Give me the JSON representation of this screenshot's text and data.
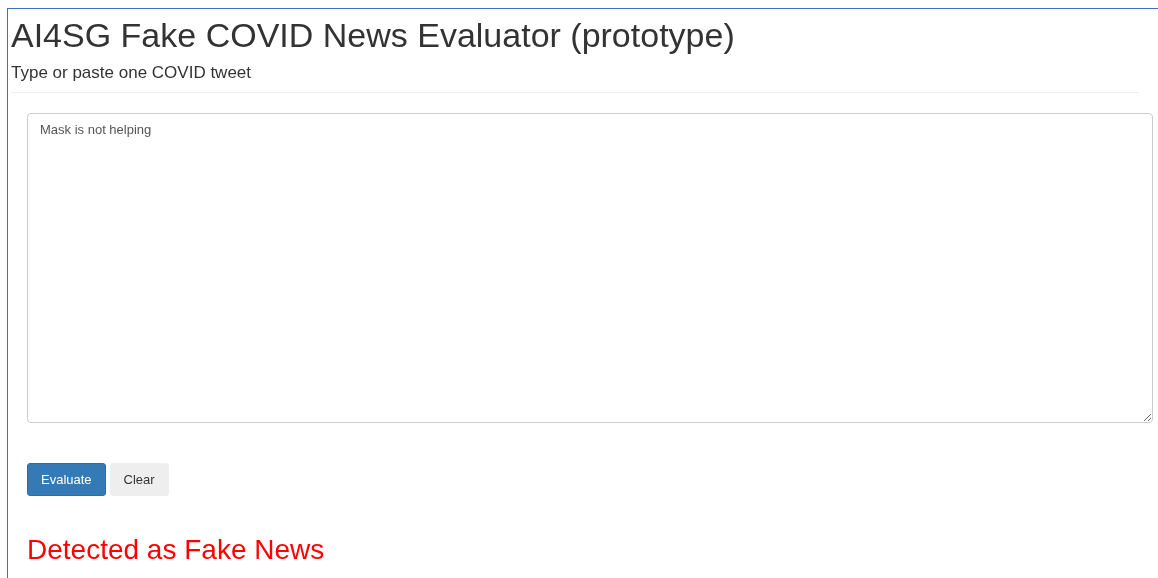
{
  "header": {
    "title": "AI4SG Fake COVID News Evaluator (prototype)",
    "subtitle": "Type or paste one COVID tweet"
  },
  "tweet_input": {
    "value": "Mask is not helping"
  },
  "buttons": [
    {
      "label": "Evaluate",
      "kind": "primary"
    },
    {
      "label": "Clear",
      "kind": "default"
    }
  ],
  "result": {
    "text": "Detected as Fake News",
    "kind": "fake"
  }
}
